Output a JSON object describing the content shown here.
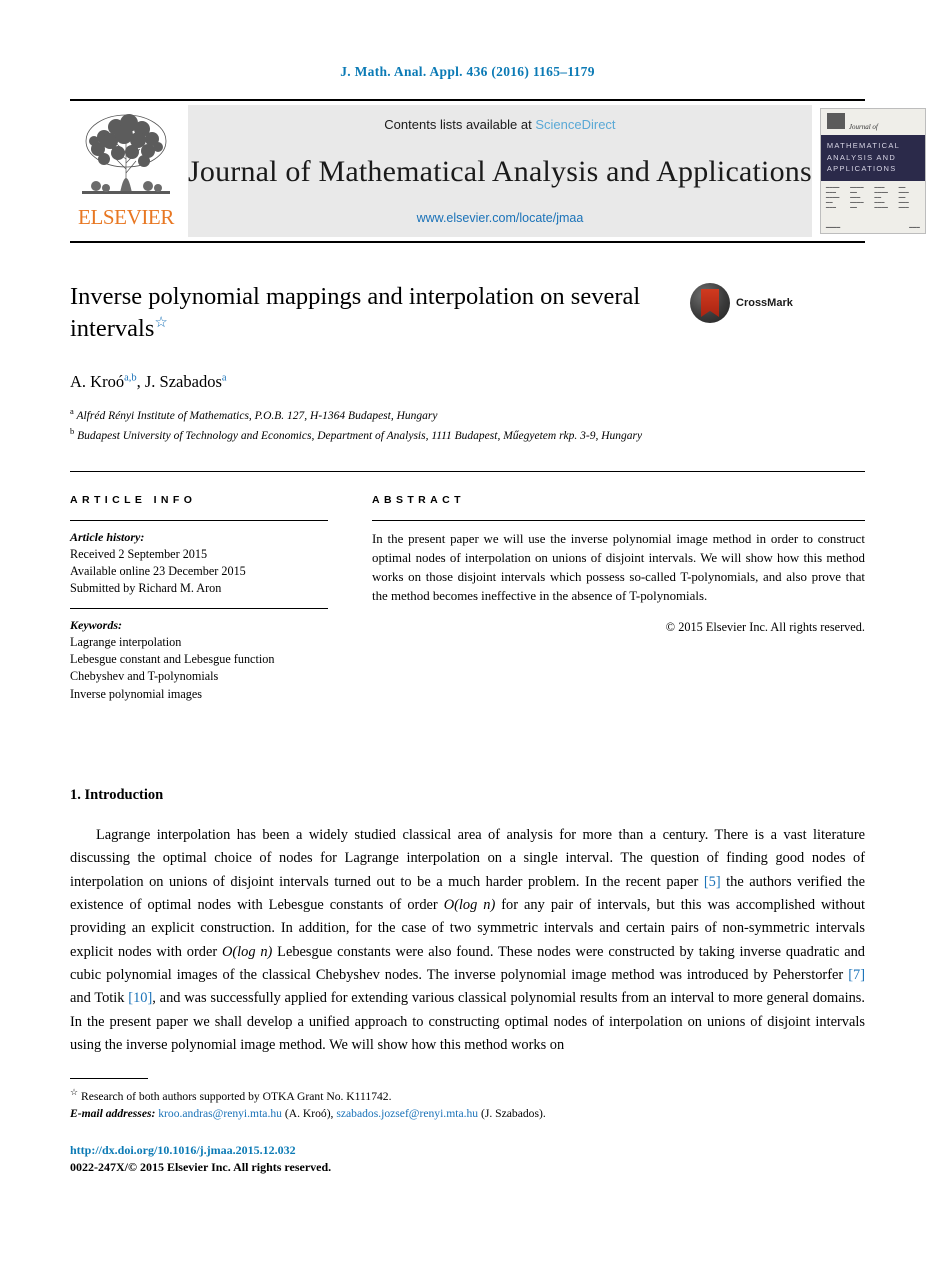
{
  "journal_ref": "J. Math. Anal. Appl. 436 (2016) 1165–1179",
  "masthead": {
    "elsevier_wordmark": "ELSEVIER",
    "contents_prefix": "Contents lists available at",
    "sciencedirect": "ScienceDirect",
    "journal_title": "Journal of Mathematical Analysis and Applications",
    "journal_url": "www.elsevier.com/locate/jmaa",
    "cover": {
      "journal_of": "Journal of",
      "band_line1": "MATHEMATICAL",
      "band_line2": "ANALYSIS AND",
      "band_line3": "APPLICATIONS"
    }
  },
  "article": {
    "title": "Inverse polynomial mappings and interpolation on several intervals",
    "title_star": "☆",
    "crossmark_label": "CrossMark",
    "authors": "A. Kroó",
    "author1_sup": "a,b",
    "author2": ", J. Szabados",
    "author2_sup": "a",
    "affiliation_a": "Alfréd Rényi Institute of Mathematics, P.O.B. 127, H-1364 Budapest, Hungary",
    "affiliation_b": "Budapest University of Technology and Economics, Department of Analysis, 1111 Budapest, Műegyetem rkp. 3-9, Hungary"
  },
  "info": {
    "heading": "ARTICLE INFO",
    "history_label": "Article history:",
    "history_lines": [
      "Received 2 September 2015",
      "Available online 23 December 2015",
      "Submitted by Richard M. Aron"
    ],
    "keywords_label": "Keywords:",
    "keywords": [
      "Lagrange interpolation",
      "Lebesgue constant and Lebesgue function",
      "Chebyshev and T-polynomials",
      "Inverse polynomial images"
    ]
  },
  "abstract": {
    "heading": "ABSTRACT",
    "text": "In the present paper we will use the inverse polynomial image method in order to construct optimal nodes of interpolation on unions of disjoint intervals. We will show how this method works on those disjoint intervals which possess so-called T-polynomials, and also prove that the method becomes ineffective in the absence of T-polynomials.",
    "copyright": "© 2015 Elsevier Inc. All rights reserved."
  },
  "introduction": {
    "heading": "1. Introduction",
    "p1_a": "Lagrange interpolation has been a widely studied classical area of analysis for more than a century. There is a vast literature discussing the optimal choice of nodes for Lagrange interpolation on a single interval. The question of finding good nodes of interpolation on unions of disjoint intervals turned out to be a much harder problem. In the recent paper ",
    "cite5": "[5]",
    "p1_b": " the authors verified the existence of optimal nodes with Lebesgue constants of order ",
    "math1": "O(log n)",
    "p1_c": " for any pair of intervals, but this was accomplished without providing an explicit construction. In addition, for the case of two symmetric intervals and certain pairs of non-symmetric intervals explicit nodes with order ",
    "math2": "O(log n)",
    "p1_d": " Lebesgue constants were also found. These nodes were constructed by taking inverse quadratic and cubic polynomial images of the classical Chebyshev nodes. The inverse polynomial image method was introduced by Peherstorfer ",
    "cite7": "[7]",
    "p1_e": " and Totik ",
    "cite10": "[10]",
    "p1_f": ", and was successfully applied for extending various classical polynomial results from an interval to more general domains. In the present paper we shall develop a unified approach to constructing optimal nodes of interpolation on unions of disjoint intervals using the inverse polynomial image method. We will show how this method works on"
  },
  "footnotes": {
    "star": "☆",
    "grant": "Research of both authors supported by OTKA Grant No. K111742.",
    "email_label": "E-mail addresses:",
    "email1": "kroo.andras@renyi.mta.hu",
    "email1_who": "(A. Kroó),",
    "email2": "szabados.jozsef@renyi.mta.hu",
    "email2_who": "(J. Szabados)."
  },
  "footer": {
    "doi": "http://dx.doi.org/10.1016/j.jmaa.2015.12.032",
    "issn": "0022-247X/© 2015 Elsevier Inc. All rights reserved."
  },
  "colors": {
    "link_blue": "#1a72b8",
    "header_blue": "#0b7ab5",
    "elsevier_orange": "#E87722",
    "cover_band": "#2b2a4a"
  }
}
